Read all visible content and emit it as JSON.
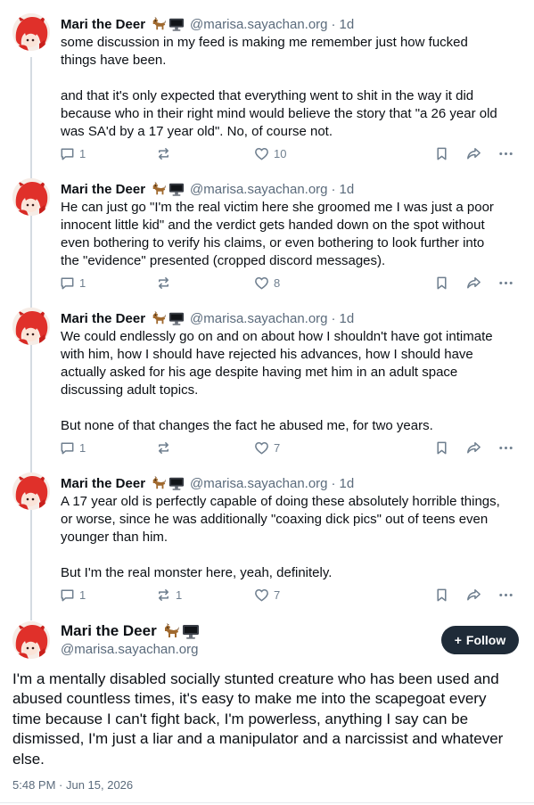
{
  "author": {
    "name": "Mari the Deer",
    "handle": "@marisa.sayachan.org",
    "badge_icons": [
      "dog-emoji-icon",
      "computer-monitor-icon"
    ]
  },
  "replies": [
    {
      "time": "1d",
      "text": "some discussion in my feed is making me remember just how fucked things have been.\n\nand that it's only expected that everything went to shit in the way it did because who in their right mind would believe the story that \"a 26 year old was SA'd by a 17 year old\". No, of course not.",
      "reply_count": "1",
      "repost_count": "",
      "like_count": "10"
    },
    {
      "time": "1d",
      "text": "He can just go \"I'm the real victim here she groomed me I was just a poor innocent little kid\" and the verdict gets handed down on the spot without even bothering to verify his claims, or even bothering to look further into the \"evidence\" presented (cropped discord messages).",
      "reply_count": "1",
      "repost_count": "",
      "like_count": "8"
    },
    {
      "time": "1d",
      "text": "We could endlessly go on and on about how I shouldn't have got intimate with him, how I should have rejected his advances, how I should have actually asked for his age despite having met him in an adult space discussing adult topics.\n\nBut none of that changes the fact he abused me, for two years.",
      "reply_count": "1",
      "repost_count": "",
      "like_count": "7"
    },
    {
      "time": "1d",
      "text": "A 17 year old is perfectly capable of doing these absolutely horrible things, or worse, since he was additionally \"coaxing dick pics\" out of teens even younger than him.\n\nBut I'm the real monster here, yeah, definitely.",
      "reply_count": "1",
      "repost_count": "1",
      "like_count": "7"
    }
  ],
  "main_post": {
    "follow_label": "Follow",
    "text": "I'm a mentally disabled socially stunted creature who has been used and abused countless times, it's easy to make me into the scapegoat every time because I can't fight back, I'm powerless, anything I say can be dismissed, I'm just a liar and a manipulator and a narcissist and whatever else.",
    "date": "5:48 PM · Jun 15, 2026"
  },
  "colors": {
    "text": "#0b0f14",
    "muted": "#5b6b7c",
    "icon": "#6f7f8f",
    "thread_line": "#d4dbe2",
    "follow_bg": "#1f2b38",
    "avatar_hair": "#e0302a"
  }
}
